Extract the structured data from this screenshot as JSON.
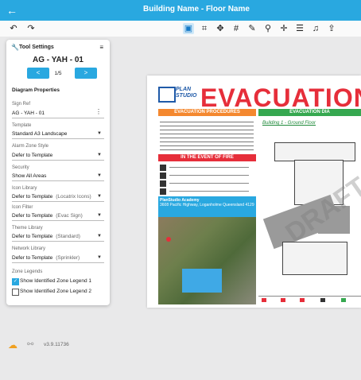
{
  "window": {
    "title": "Building Name - Floor Name",
    "back_icon": "arrow-left-icon"
  },
  "toolbar": {
    "undo_icon": "undo-icon",
    "redo_icon": "redo-icon",
    "tools": [
      "select-icon",
      "crop-icon",
      "grid-icon",
      "hash-icon",
      "brush-icon",
      "eyedropper-icon",
      "node-icon",
      "layers-icon",
      "headphones-icon",
      "upload-icon"
    ]
  },
  "panel": {
    "title": "Tool Settings",
    "sheet_name": "AG - YAH - 01",
    "prev_label": "<",
    "next_label": ">",
    "page": "1/5",
    "section_title": "Diagram Properties",
    "fields": [
      {
        "label": "Sign Ref",
        "value": "AG - YAH - 01",
        "hint": ""
      },
      {
        "label": "Template",
        "value": "Standard A3 Landscape",
        "hint": ""
      },
      {
        "label": "Alarm Zone Style",
        "value": "Defer to Template",
        "hint": ""
      },
      {
        "label": "Security",
        "value": "Show All Areas",
        "hint": ""
      },
      {
        "label": "Icon Library",
        "value": "Defer to Template",
        "hint": "(Locatrix Icons)"
      },
      {
        "label": "Icon Filter",
        "value": "Defer to Template",
        "hint": "(Evac Sign)"
      },
      {
        "label": "Theme Library",
        "value": "Defer to Template",
        "hint": "(Standard)"
      },
      {
        "label": "Network Library",
        "value": "Defer to Template",
        "hint": "(Sprinkler)"
      }
    ],
    "zone_legends_label": "Zone Legends",
    "checkboxes": [
      {
        "label": "Show Identified Zone Legend 1",
        "checked": true
      },
      {
        "label": "Show Identified Zone Legend 2",
        "checked": false
      }
    ]
  },
  "document": {
    "logo_line1": "PLAN",
    "logo_line2": "STUDIO",
    "title": "EVACUATION",
    "procedures_header": "EVACUATION PROCEDURES",
    "diagram_header": "EVACUATION DIA",
    "fire_header": "IN THE EVENT OF FIRE",
    "floor_label": "Building 1 - Ground Floor",
    "academy_name": "PlanStudio Academy",
    "academy_address": "3608 Pacific Highway, Loganholme Queensland 4129",
    "watermark": "DRAFT"
  },
  "footer": {
    "cloud_icon": "cloud-icon",
    "link_icon": "no-link-icon",
    "version": "v3.9.11736"
  }
}
